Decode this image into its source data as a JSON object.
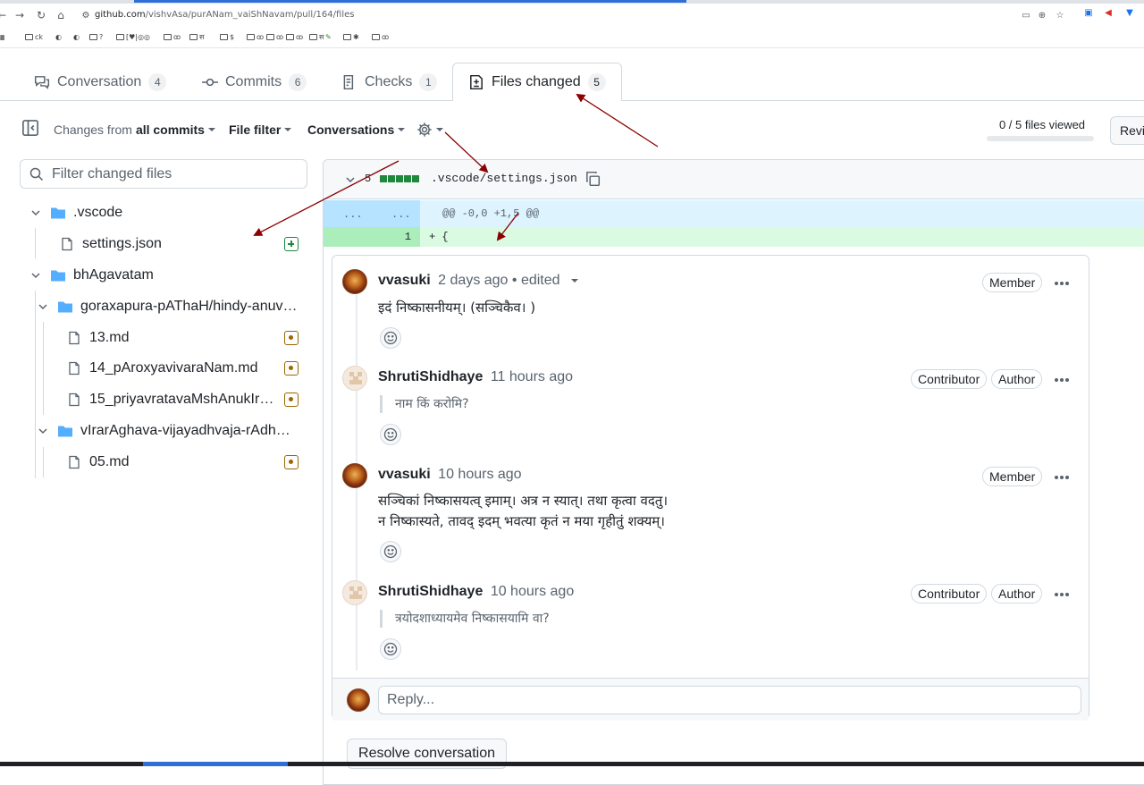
{
  "browser": {
    "url_host": "github.com",
    "url_path": "/vishvAsa/purANam_vaiShNavam/pull/164/files",
    "bookmarks": [
      "ck",
      "?",
      "[♥|◎◎",
      "ꝏ",
      "स",
      "$",
      "ꝏ",
      "ꝏ",
      "ꝏ",
      "स",
      "ꝏ",
      "ꝏ",
      "✱",
      "ꝏ"
    ]
  },
  "tabs": [
    {
      "label": "Conversation",
      "count": "4",
      "icon": "comment-discussion-icon"
    },
    {
      "label": "Commits",
      "count": "6",
      "icon": "git-commit-icon"
    },
    {
      "label": "Checks",
      "count": "1",
      "icon": "checklist-icon"
    },
    {
      "label": "Files changed",
      "count": "5",
      "icon": "file-diff-icon",
      "selected": true
    }
  ],
  "toolbar": {
    "changes_prefix": "Changes from",
    "changes_value": "all commits",
    "file_filter": "File filter",
    "conversations": "Conversations",
    "files_viewed": "0 / 5 files viewed",
    "files_viewed_fraction": 0,
    "review_button": "Revi"
  },
  "file_tree": {
    "filter_placeholder": "Filter changed files",
    "items": [
      {
        "label": ".vscode",
        "type": "folder"
      },
      {
        "label": "settings.json",
        "type": "file",
        "status": "added"
      },
      {
        "label": "bhAgavatam",
        "type": "folder"
      },
      {
        "label": "goraxapura-pAThaH/hindy-anuv…",
        "type": "folder"
      },
      {
        "label": "13.md",
        "type": "file",
        "status": "modified"
      },
      {
        "label": "14_pAroxyavivaraNam.md",
        "type": "file",
        "status": "modified"
      },
      {
        "label": "15_priyavratavaMshAnukIr…",
        "type": "file",
        "status": "modified"
      },
      {
        "label": "vIrarAghava-vijayadhvaja-rAdhA…",
        "type": "folder"
      },
      {
        "label": "05.md",
        "type": "file",
        "status": "modified"
      }
    ]
  },
  "diff": {
    "change_count": "5",
    "file_path": ".vscode/settings.json",
    "hunk_left": "...",
    "hunk_right": "...",
    "hunk_header": "@@ -0,0 +1,5 @@",
    "added_line_number": "1",
    "added_line_code": "+ {"
  },
  "comments": [
    {
      "author": "vvasuki",
      "time": "2 days ago",
      "edited": "• edited",
      "badges": [
        "Member"
      ],
      "body": [
        "इदं निष्कासनीयम्। (सञ्चिकैव। )"
      ],
      "quoted": false
    },
    {
      "author": "ShrutiShidhaye",
      "time": "11 hours ago",
      "badges": [
        "Contributor",
        "Author"
      ],
      "body": [
        "नाम किं करोमि?"
      ],
      "quoted": true
    },
    {
      "author": "vvasuki",
      "time": "10 hours ago",
      "badges": [
        "Member"
      ],
      "body": [
        "सञ्चिकां निष्कासयत्व् इमाम्। अत्र न स्यात्। तथा कृत्वा वदतु।",
        "न निष्कास्यते, तावद् इदम् भवत्या कृतं न मया गृहीतुं शक्यम्।"
      ],
      "quoted": false
    },
    {
      "author": "ShrutiShidhaye",
      "time": "10 hours ago",
      "badges": [
        "Contributor",
        "Author"
      ],
      "body": [
        "त्रयोदशाध्यायमेव निष्कासयामि वा?"
      ],
      "quoted": true
    }
  ],
  "reply": {
    "placeholder": "Reply..."
  },
  "resolve_button": "Resolve conversation",
  "colors": {
    "added": "#1f883d",
    "modified": "#9a6700",
    "annotation_arrow": "#8b0000"
  }
}
